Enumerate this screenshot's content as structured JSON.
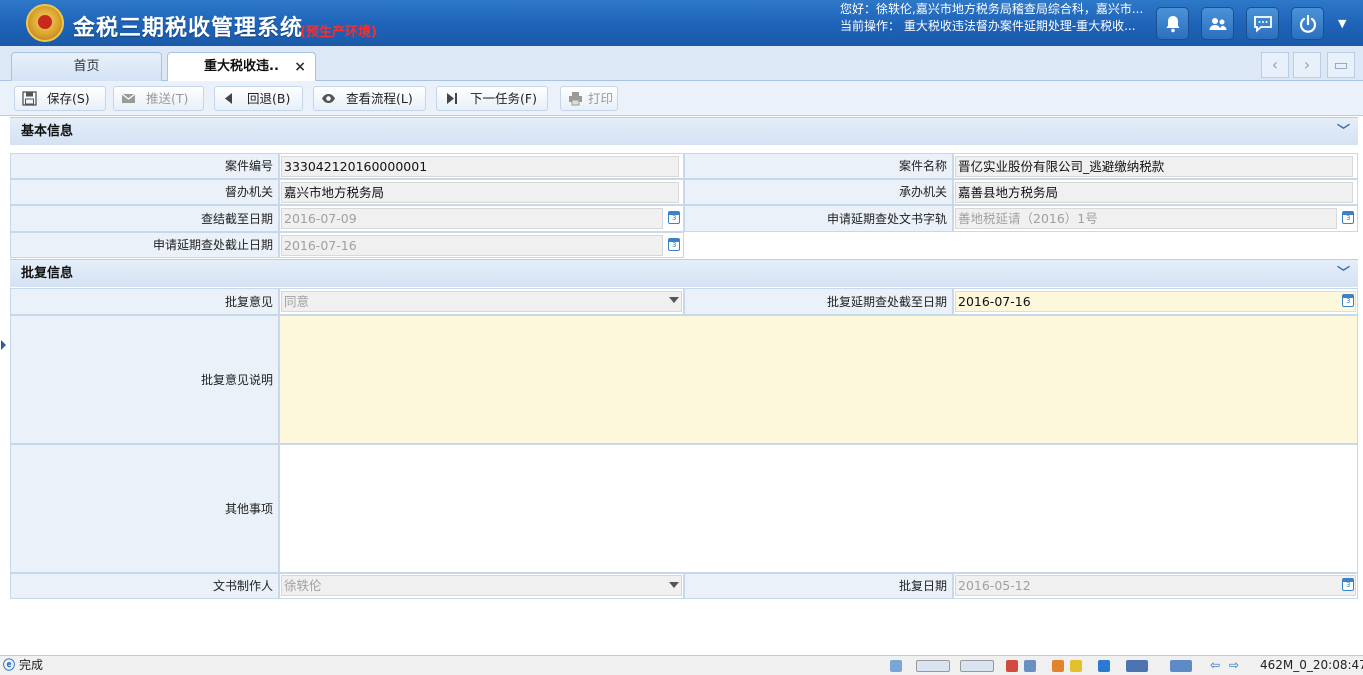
{
  "app": {
    "title": "金税三期税收管理系统",
    "env_tag": "(预生产环境)",
    "user_line": "您好：徐轶伦,嘉兴市地方税务局稽查局综合科，嘉兴市...",
    "op_line": "当前操作： 重大税收违法督办案件延期处理-重大税收..."
  },
  "header_icons": [
    "bell-icon",
    "users-icon",
    "chat-icon",
    "power-icon"
  ],
  "tabs": [
    {
      "label": "首页",
      "active": false
    },
    {
      "label": "重大税收违..",
      "active": true,
      "close": "×"
    }
  ],
  "toolbar": {
    "save": "保存(S)",
    "send": "推送(T)",
    "back": "回退(B)",
    "flow": "查看流程(L)",
    "next": "下一任务(F)",
    "print": "打印"
  },
  "basic": {
    "title": "基本信息",
    "case_no_label": "案件编号",
    "case_no": "333042120160000001",
    "case_name_label": "案件名称",
    "case_name": "晋亿实业股份有限公司_逃避缴纳税款",
    "supervise_label": "督办机关",
    "supervise": "嘉兴市地方税务局",
    "handle_label": "承办机关",
    "handle": "嘉善县地方税务局",
    "deadline_label": "查结截至日期",
    "deadline": "2016-07-09",
    "doc_no_label": "申请延期查处文书字轨",
    "doc_no": "善地税延请（2016）1号",
    "ext_label": "申请延期查处截止日期",
    "ext": "2016-07-16"
  },
  "reply": {
    "title": "批复信息",
    "opinion_label": "批复意见",
    "opinion": "同意",
    "reply_deadline_label": "批复延期查处截至日期",
    "reply_deadline": "2016-07-16",
    "desc_label": "批复意见说明",
    "desc": "",
    "other_label": "其他事项",
    "other": "",
    "author_label": "文书制作人",
    "author": "徐轶伦",
    "reply_date_label": "批复日期",
    "reply_date": "2016-05-12"
  },
  "status": {
    "left": "完成",
    "right": "462M_0_20:08:47"
  },
  "colors": {
    "header_blue": "#1e63b8",
    "env_red": "#ff2b2b",
    "label_bg": "#eaf1f9",
    "yellow_field": "#fdf7dc"
  }
}
